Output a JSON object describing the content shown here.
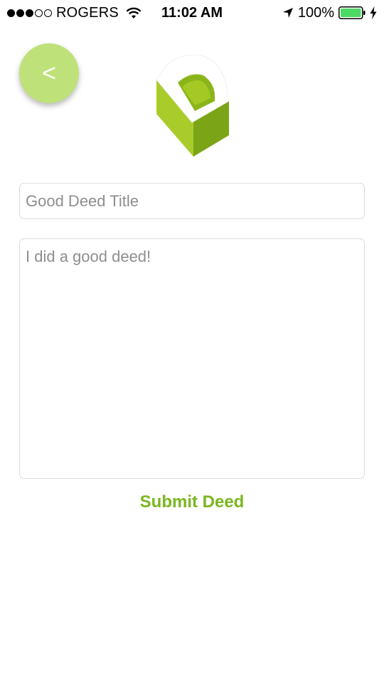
{
  "status_bar": {
    "signal_full": 3,
    "signal_total": 5,
    "carrier": "ROGERS",
    "time": "11:02 AM",
    "battery_percent": "100%",
    "icons": [
      "wifi-icon",
      "location-arrow-icon",
      "battery-icon",
      "charging-bolt-icon"
    ]
  },
  "header": {
    "back_label": "<",
    "logo_icon": "deed-logo-icon"
  },
  "form": {
    "title_placeholder": "Good Deed Title",
    "body_placeholder": "I did a good deed!",
    "submit_label": "Submit Deed"
  },
  "colors": {
    "accent": "#7bb61f",
    "back_button": "#bfe17a",
    "battery": "#4cd964"
  }
}
